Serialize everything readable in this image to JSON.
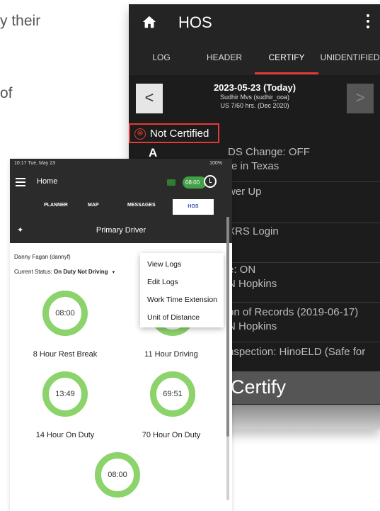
{
  "background_text": {
    "line1": "y their",
    "line2": "of"
  },
  "hos_app": {
    "title": "HOS",
    "tabs": [
      "LOG",
      "HEADER",
      "CERTIFY",
      "UNIDENTIFIED"
    ],
    "active_tab": "CERTIFY",
    "date": "2023-05-23 (Today)",
    "driver": "Sudhir Mvs (sudhir_ooa)",
    "cycle": "US 7/60 hrs. (Dec 2020)",
    "prev_label": "<",
    "next_label": ">",
    "status": "Not Certified",
    "status_icon": "⊗",
    "log_letter": "A",
    "log_items": [
      "DS Change: OFF",
      "re in Texas",
      "wer Up",
      "XRS Login",
      "e: ON",
      "N Hopkins",
      "on of Records (2019-06-17)",
      "N Hopkins",
      "nspection: HinoELD (Safe for"
    ],
    "certify_label": "Certify",
    "accent_color": "#e53935"
  },
  "home_app": {
    "status_bar": {
      "left": "10:17  Tue, May 23",
      "right": "100%"
    },
    "title": "Home",
    "timer": "08:00",
    "nav_tabs": [
      "PLANNER",
      "MAP",
      "MESSAGES",
      "HOS"
    ],
    "active_nav": "HOS",
    "primary_driver": "Primary Driver",
    "pin_icon": "✦",
    "user": "Danny Fagan  (dannyf)",
    "current_status_label": "Current Status:",
    "current_status_value": "On Duty Not Driving",
    "menu": [
      "View Logs",
      "Edit Logs",
      "Work Time Extension",
      "Unit of Distance"
    ],
    "timers": [
      {
        "value": "08:00",
        "label": "8 Hour Rest Break"
      },
      {
        "value": "",
        "label": "11 Hour Driving"
      },
      {
        "value": "13:49",
        "label": "14 Hour On Duty"
      },
      {
        "value": "69:51",
        "label": "70 Hour On Duty"
      },
      {
        "value": "08:00",
        "label": ""
      }
    ],
    "ring_color": "#8bd36a"
  }
}
